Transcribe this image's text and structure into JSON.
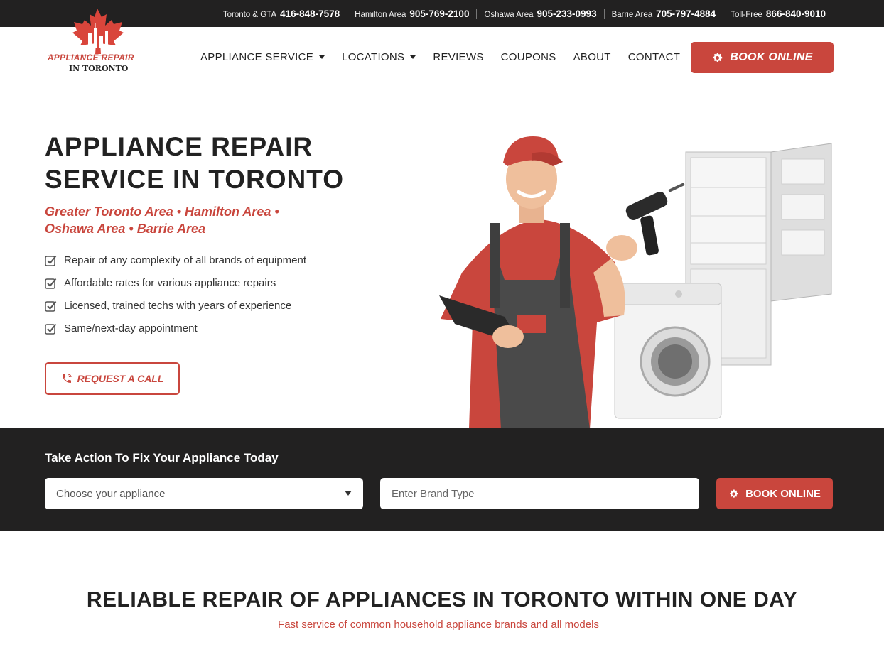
{
  "topbar": {
    "phones": [
      {
        "area": "Toronto & GTA",
        "number": "416-848-7578"
      },
      {
        "area": "Hamilton Area",
        "number": "905-769-2100"
      },
      {
        "area": "Oshawa Area",
        "number": "905-233-0993"
      },
      {
        "area": "Barrie Area",
        "number": "705-797-4884"
      },
      {
        "area": "Toll-Free",
        "number": "866-840-9010"
      }
    ]
  },
  "logo": {
    "line1": "APPLIANCE REPAIR",
    "line2": "IN TORONTO"
  },
  "nav": {
    "items": [
      "APPLIANCE SERVICE",
      "LOCATIONS",
      "REVIEWS",
      "COUPONS",
      "ABOUT",
      "CONTACT"
    ],
    "book_label": "BOOK ONLINE"
  },
  "hero": {
    "title_line1": "APPLIANCE REPAIR",
    "title_line2": "SERVICE IN TORONTO",
    "areas": "Greater Toronto Area • Hamilton Area • Oshawa Area • Barrie Area",
    "features": [
      "Repair of any complexity of all brands of equipment",
      "Affordable rates for various appliance repairs",
      "Licensed, trained techs with years of experience",
      "Same/next-day appointment"
    ],
    "request_label": "REQUEST A CALL"
  },
  "action": {
    "heading": "Take Action To Fix Your Appliance Today",
    "select_value": "Choose your appliance",
    "brand_placeholder": "Enter Brand Type",
    "book_label": "BOOK ONLINE"
  },
  "section": {
    "title": "RELIABLE REPAIR OF APPLIANCES IN TORONTO WITHIN ONE DAY",
    "subtitle": "Fast service of common household appliance brands and all models"
  },
  "colors": {
    "accent": "#c9463d",
    "dark": "#222121"
  }
}
